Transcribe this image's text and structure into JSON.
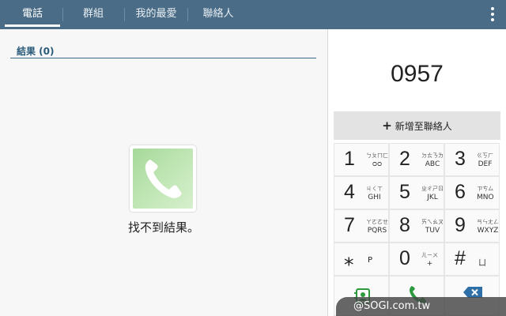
{
  "tabs": [
    {
      "label": "電話",
      "active": true
    },
    {
      "label": "群組",
      "active": false
    },
    {
      "label": "我的最愛",
      "active": false
    },
    {
      "label": "聯絡人",
      "active": false
    }
  ],
  "results": {
    "header": "結果 (0)",
    "empty_text": "找不到結果。"
  },
  "dialer": {
    "number": "0957",
    "add_contact_label": "新增至聯絡人",
    "keys": [
      {
        "digit": "1",
        "zh": "ㄅㄆㄇㄈ",
        "en": "ᴑᴑ"
      },
      {
        "digit": "2",
        "zh": "ㄉㄊㄋㄌ",
        "en": "ABC"
      },
      {
        "digit": "3",
        "zh": "ㄍㄎㄏ",
        "en": "DEF"
      },
      {
        "digit": "4",
        "zh": "ㄐㄑㄒ",
        "en": "GHI"
      },
      {
        "digit": "5",
        "zh": "ㄓㄔㄕㄖ",
        "en": "JKL"
      },
      {
        "digit": "6",
        "zh": "ㄗㄘㄙ",
        "en": "MNO"
      },
      {
        "digit": "7",
        "zh": "ㄚㄛㄜㄝ",
        "en": "PQRS"
      },
      {
        "digit": "8",
        "zh": "ㄞㄟㄠㄡ",
        "en": "TUV"
      },
      {
        "digit": "9",
        "zh": "ㄢㄣㄤㄥ",
        "en": "WXYZ"
      },
      {
        "digit": "⁎",
        "zh": "",
        "en": "P"
      },
      {
        "digit": "0",
        "zh": "ㄦㄧㄨ",
        "en": "+"
      },
      {
        "digit": "#",
        "zh": "",
        "en": "ㄩ"
      }
    ]
  },
  "icons": {
    "overflow": "overflow-menu-icon",
    "empty": "phone-handset-icon",
    "contacts": "contact-card-icon",
    "call": "call-icon",
    "backspace": "backspace-icon"
  },
  "colors": {
    "tab_bar": "#4a6c86",
    "call_green": "#2e9a3e",
    "backspace_blue": "#2e6fa8"
  },
  "watermark": "@SOGI.com.tw"
}
